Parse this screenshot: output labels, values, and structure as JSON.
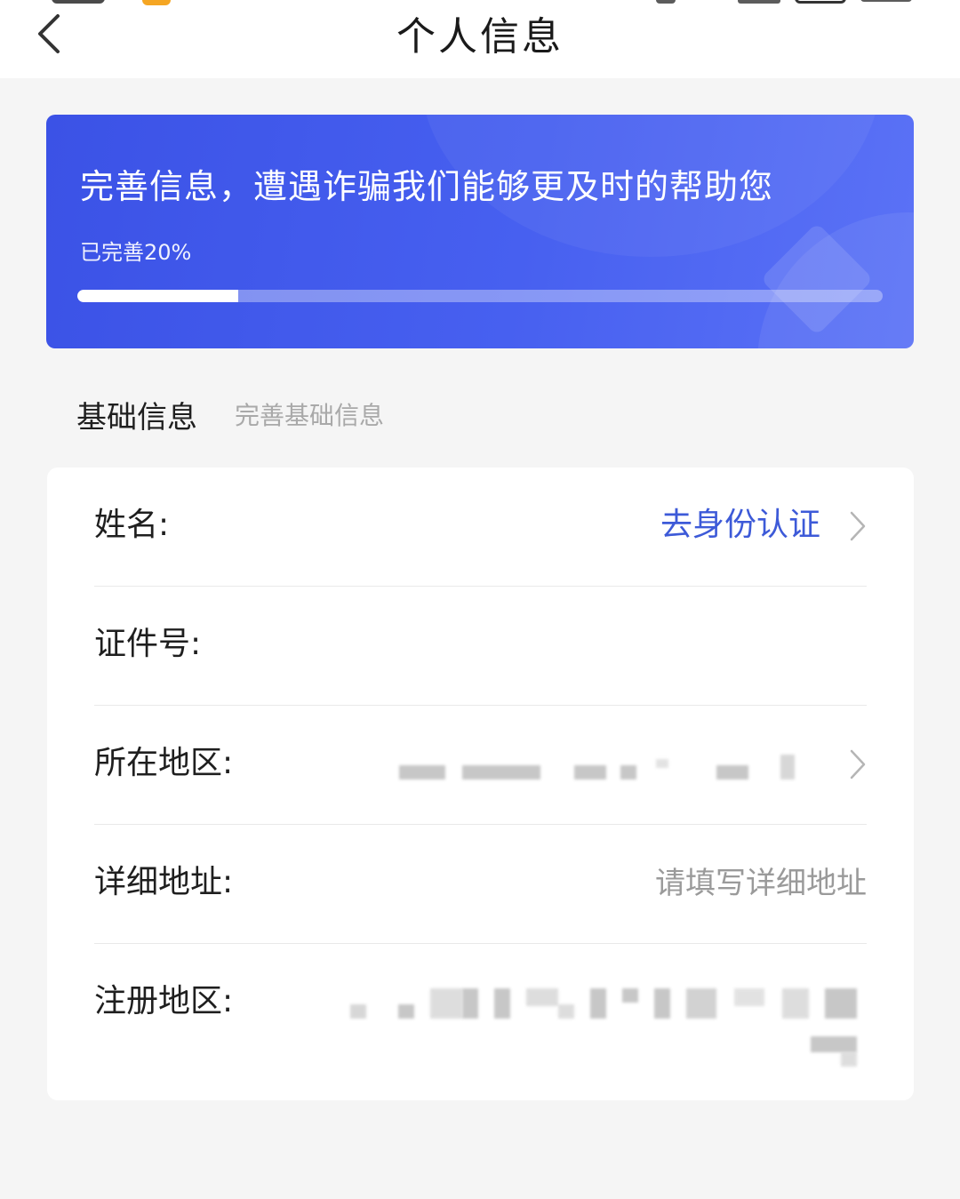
{
  "header": {
    "title": "个人信息"
  },
  "banner": {
    "slogan": "完善信息，遭遇诈骗我们能够更及时的帮助您",
    "progress_text": "已完善20%",
    "progress_value": 0.2,
    "color": "#4760f0"
  },
  "section": {
    "title": "基础信息",
    "subtitle": "完善基础信息"
  },
  "form": {
    "name_label": "姓名:",
    "name_action": "去身份认证",
    "id_label": "证件号:",
    "region_label": "所在地区:",
    "address_label": "详细地址:",
    "address_placeholder": "请填写详细地址",
    "registered_region_label": "注册地区:"
  },
  "colors": {
    "accent": "#3d5ad8",
    "background": "#f5f5f5"
  },
  "icons": {
    "back": "chevron-left-icon",
    "row_arrow": "chevron-right-icon"
  }
}
